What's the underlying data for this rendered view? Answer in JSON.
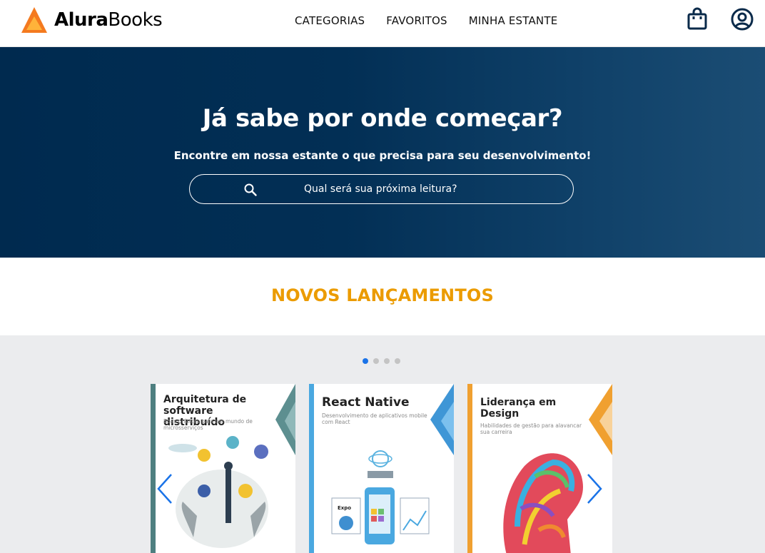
{
  "header": {
    "logo_bold": "Alura",
    "logo_light": "Books",
    "nav": [
      "CATEGORIAS",
      "FAVORITOS",
      "MINHA ESTANTE"
    ]
  },
  "hero": {
    "title": "Já sabe por onde começar?",
    "subtitle": "Encontre em nossa estante o que precisa para seu desenvolvimento!",
    "search_placeholder": "Qual será sua próxima leitura?"
  },
  "section": {
    "title": "NOVOS LANÇAMENTOS"
  },
  "carousel": {
    "dot_count": 4,
    "active_dot": 1,
    "books": [
      {
        "title": "Arquitetura de software distribuído",
        "subtitle": "Boas práticas para um mundo de microsserviços",
        "badges": [
          "GO",
          "PHP",
          "JAVA SCRIPT",
          "PYTHON",
          "JAVA"
        ]
      },
      {
        "title": "React Native",
        "subtitle": "Desenvolvimento de aplicativos mobile com React",
        "badges": [
          "Expo"
        ]
      },
      {
        "title": "Liderança em Design",
        "subtitle": "Habilidades de gestão para alavancar sua carreira",
        "badges": []
      }
    ]
  },
  "colors": {
    "hero_dark": "#002a4f",
    "hero_light": "#1b4d74",
    "accent_orange": "#eb9b00",
    "dot_active": "#1a73e8",
    "carousel_bg": "#ebecee",
    "arrow_blue": "#1a73e8",
    "book1_stripe": "#4e7f80",
    "book2_stripe": "#4aa8e0",
    "book3_stripe": "#f0a030"
  },
  "icons": {
    "logo": "triangle-logo-icon",
    "bag": "shopping-bag-icon",
    "user": "user-circle-icon",
    "search": "search-icon",
    "left": "chevron-left-icon",
    "right": "chevron-right-icon"
  }
}
